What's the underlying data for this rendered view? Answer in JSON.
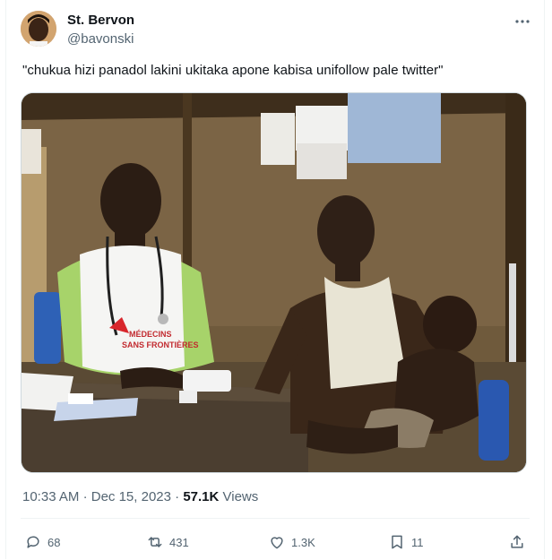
{
  "author": {
    "name": "St. Bervon",
    "handle": "@bavonski"
  },
  "tweet": {
    "text": "\"chukua hizi panadol lakini ukitaka apone kabisa unifollow pale twitter\""
  },
  "photo": {
    "vest_text_line1": "MÉDECINS",
    "vest_text_line2": "SANS FRONTIÈRES"
  },
  "meta": {
    "time": "10:33 AM",
    "separator": "·",
    "date": "Dec 15, 2023",
    "views_count": "57.1K",
    "views_label": "Views"
  },
  "actions": {
    "replies": "68",
    "reposts": "431",
    "likes": "1.3K",
    "bookmarks": "11"
  },
  "icons": [
    "more-icon",
    "reply-icon",
    "repost-icon",
    "like-icon",
    "bookmark-icon",
    "share-icon"
  ],
  "colors": {
    "text": "#0f1419",
    "secondary": "#536471",
    "border": "#eff3f4"
  }
}
